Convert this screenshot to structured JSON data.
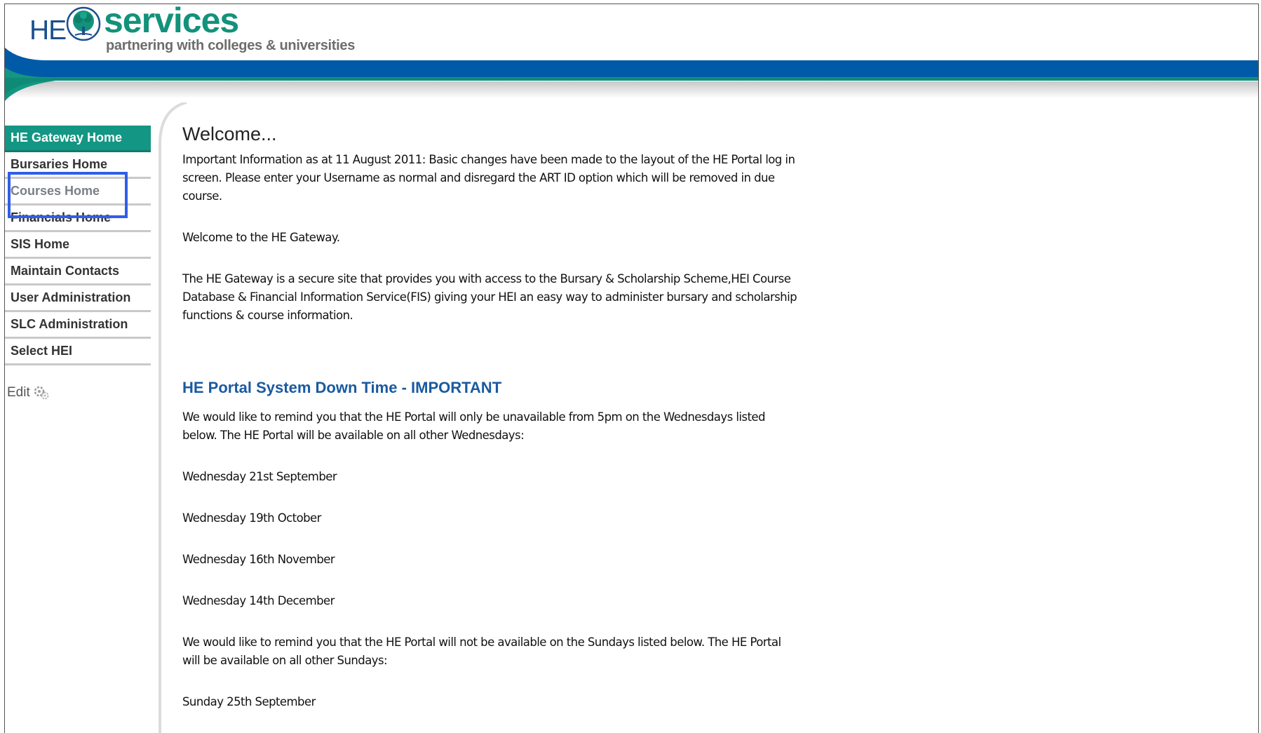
{
  "brand": {
    "prefix": "HE",
    "name": "services",
    "tagline": "partnering with colleges & universities",
    "colors": {
      "teal": "#139683",
      "blue": "#005aa7",
      "navy": "#1c4f8f"
    }
  },
  "sidebar": {
    "items": [
      {
        "label": "HE Gateway Home",
        "state": "active"
      },
      {
        "label": "Bursaries Home"
      },
      {
        "label": "Courses Home",
        "state": "highlighted"
      },
      {
        "label": "Financials Home"
      },
      {
        "label": "SIS Home"
      },
      {
        "label": "Maintain Contacts"
      },
      {
        "label": "User Administration"
      },
      {
        "label": "SLC Administration"
      },
      {
        "label": "Select HEI"
      }
    ],
    "edit_label": "Edit",
    "edit_icon": "gears-icon"
  },
  "main": {
    "title": "Welcome...",
    "notice": "Important Information as at 11 August 2011: Basic changes have been made to the layout of the HE Portal log in screen. Please enter your Username as normal and disregard the ART ID option which will be removed in due course.",
    "greeting": "Welcome to the HE Gateway.",
    "description": "The HE Gateway is a secure site that provides you with access to the Bursary & Scholarship Scheme,HEI Course Database & Financial Information Service(FIS) giving your HEI an easy way to administer bursary and scholarship functions & course information.",
    "downtime": {
      "heading": "HE Portal System Down Time - IMPORTANT",
      "wednesday_intro": "We would like to remind you that the HE Portal will only be unavailable from 5pm on the Wednesdays listed below. The HE Portal will be available on all other Wednesdays:",
      "wednesdays": [
        "Wednesday 21st September",
        "Wednesday 19th October",
        "Wednesday 16th November",
        "Wednesday 14th December"
      ],
      "sunday_intro": "We would like to remind you that the HE Portal will not be available on the Sundays listed below. The HE Portal will be available on all other Sundays:",
      "sundays": [
        "Sunday 25th September"
      ]
    }
  }
}
